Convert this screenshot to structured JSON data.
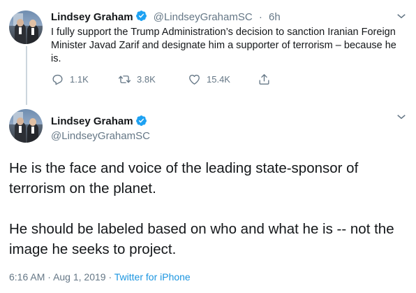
{
  "colors": {
    "accent": "#1da1f2",
    "muted": "#657786",
    "text": "#14171a"
  },
  "tweet1": {
    "name": "Lindsey Graham",
    "handle": "@LindseyGrahamSC",
    "separator": "·",
    "time": "6h",
    "text": "I fully support the Trump Administration’s decision to sanction Iranian Foreign Minister Javad Zarif and designate him a supporter of terrorism – because he is.",
    "replies": "1.1K",
    "retweets": "3.8K",
    "likes": "15.4K"
  },
  "tweet2": {
    "name": "Lindsey Graham",
    "handle": "@LindseyGrahamSC",
    "paragraph1": "He is the face and voice of the leading state-sponsor of terrorism on the planet.",
    "paragraph2": "He should be labeled based on who and what he is -- not the image he seeks to project.",
    "time": "6:16 AM",
    "sep1": "·",
    "date": "Aug 1, 2019",
    "sep2": "·",
    "source": "Twitter for iPhone"
  },
  "icons": [
    "avatar",
    "verified-badge-icon",
    "chevron-down-icon",
    "reply-icon",
    "retweet-icon",
    "like-icon",
    "share-icon"
  ]
}
